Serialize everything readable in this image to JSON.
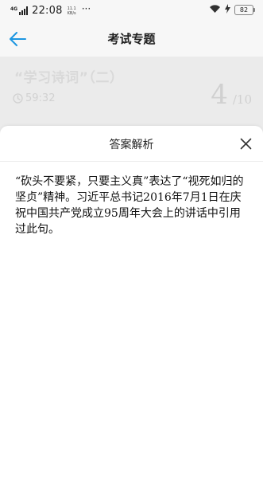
{
  "status_bar": {
    "network_label": "4G",
    "time": "22:08",
    "speed_value": "11.1",
    "speed_unit": "KB/s",
    "more": "···",
    "battery": "82"
  },
  "header": {
    "title": "考试专题",
    "accent_color": "#1e9be9"
  },
  "quiz": {
    "title": "“学习诗词”（二）",
    "timer": "59:32",
    "current": "4",
    "total": "/10"
  },
  "answer_sheet": {
    "title": "答案解析",
    "content": "“砍头不要紧，只要主义真”表达了“视死如归的坚贞”精神。习近平总书记2016年7月1日在庆祝中国共产党成立95周年大会上的讲话中引用过此句。"
  },
  "icons": {
    "back": "arrow-left-icon",
    "close": "close-icon",
    "clock": "clock-icon",
    "wifi": "wifi-icon",
    "charging": "bolt-icon"
  }
}
